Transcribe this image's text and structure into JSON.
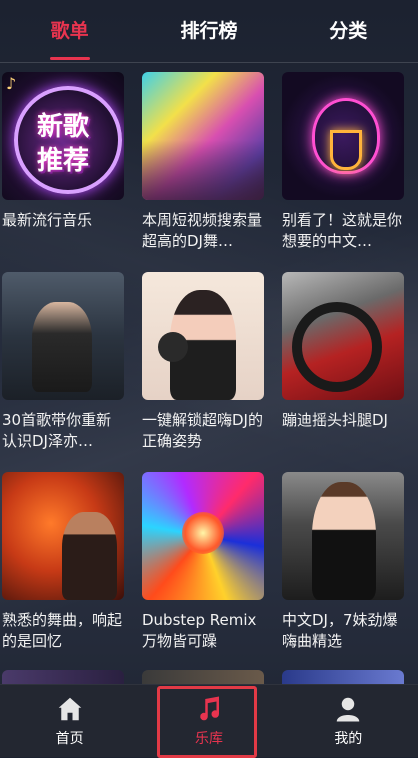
{
  "tabs": [
    {
      "label": "歌单",
      "active": true
    },
    {
      "label": "排行榜",
      "active": false
    },
    {
      "label": "分类",
      "active": false
    }
  ],
  "playlists": [
    {
      "title": "最新流行音乐",
      "cover_text": [
        "新歌",
        "推荐"
      ]
    },
    {
      "title": "本周短视频搜索量超高的DJ舞…"
    },
    {
      "title": "别看了！这就是你想要的中文…"
    },
    {
      "title": "30首歌带你重新认识DJ泽亦…"
    },
    {
      "title": "一键解锁超嗨DJ的正确姿势"
    },
    {
      "title": "蹦迪摇头抖腿DJ"
    },
    {
      "title": "熟悉的舞曲，响起的是回忆"
    },
    {
      "title": "Dubstep Remix 万物皆可躁"
    },
    {
      "title": "中文DJ，7妹劲爆嗨曲精选"
    }
  ],
  "bottom_nav": [
    {
      "label": "首页",
      "icon": "home-icon",
      "active": false
    },
    {
      "label": "乐库",
      "icon": "music-note-icon",
      "active": true
    },
    {
      "label": "我的",
      "icon": "person-icon",
      "active": false
    }
  ],
  "colors": {
    "accent": "#e8344f",
    "nav_bg": "#232731"
  }
}
